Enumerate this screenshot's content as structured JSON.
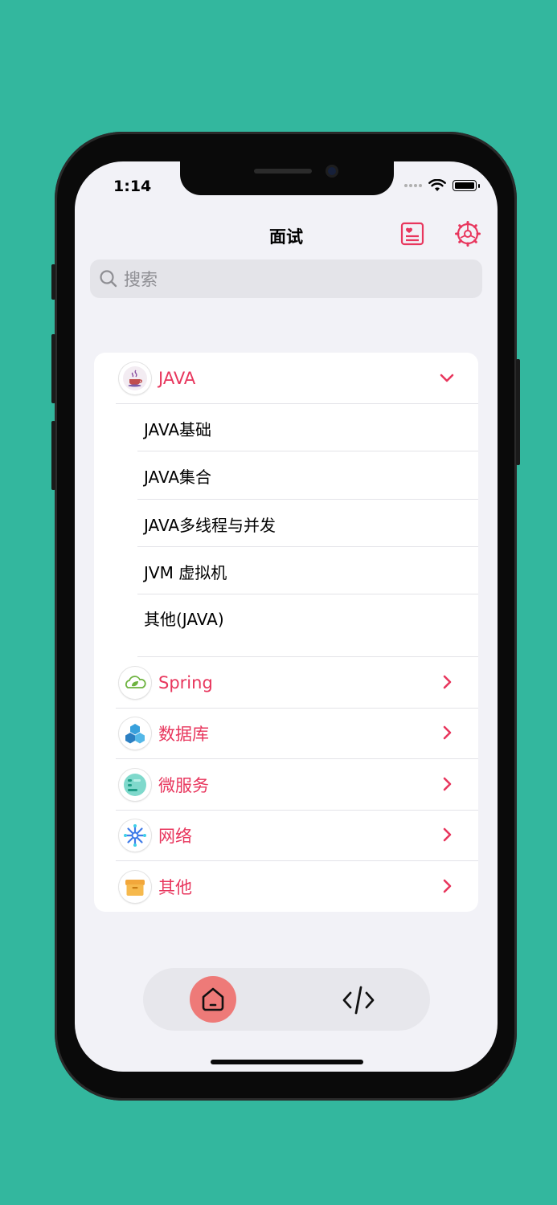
{
  "status_bar": {
    "time": "1:14"
  },
  "nav": {
    "title": "面试",
    "left_icon": "favorites-card-icon",
    "right_icon": "settings-gear-icon"
  },
  "search": {
    "placeholder": "搜索"
  },
  "categories": [
    {
      "label": "JAVA",
      "icon": "java-icon",
      "expanded": true,
      "items": [
        "JAVA基础",
        "JAVA集合",
        "JAVA多线程与并发",
        "JVM 虚拟机",
        "其他(JAVA)"
      ]
    },
    {
      "label": "Spring",
      "icon": "spring-icon",
      "expanded": false
    },
    {
      "label": "数据库",
      "icon": "database-icon",
      "expanded": false
    },
    {
      "label": "微服务",
      "icon": "microservice-icon",
      "expanded": false
    },
    {
      "label": "网络",
      "icon": "network-icon",
      "expanded": false
    },
    {
      "label": "其他",
      "icon": "box-icon",
      "expanded": false
    }
  ],
  "tabs": [
    {
      "name": "home",
      "icon": "home-icon",
      "selected": true
    },
    {
      "name": "code",
      "icon": "code-icon",
      "selected": false
    }
  ],
  "colors": {
    "background": "#33b79e",
    "accent": "#e8365d",
    "tab_selected": "#ee7a78"
  }
}
